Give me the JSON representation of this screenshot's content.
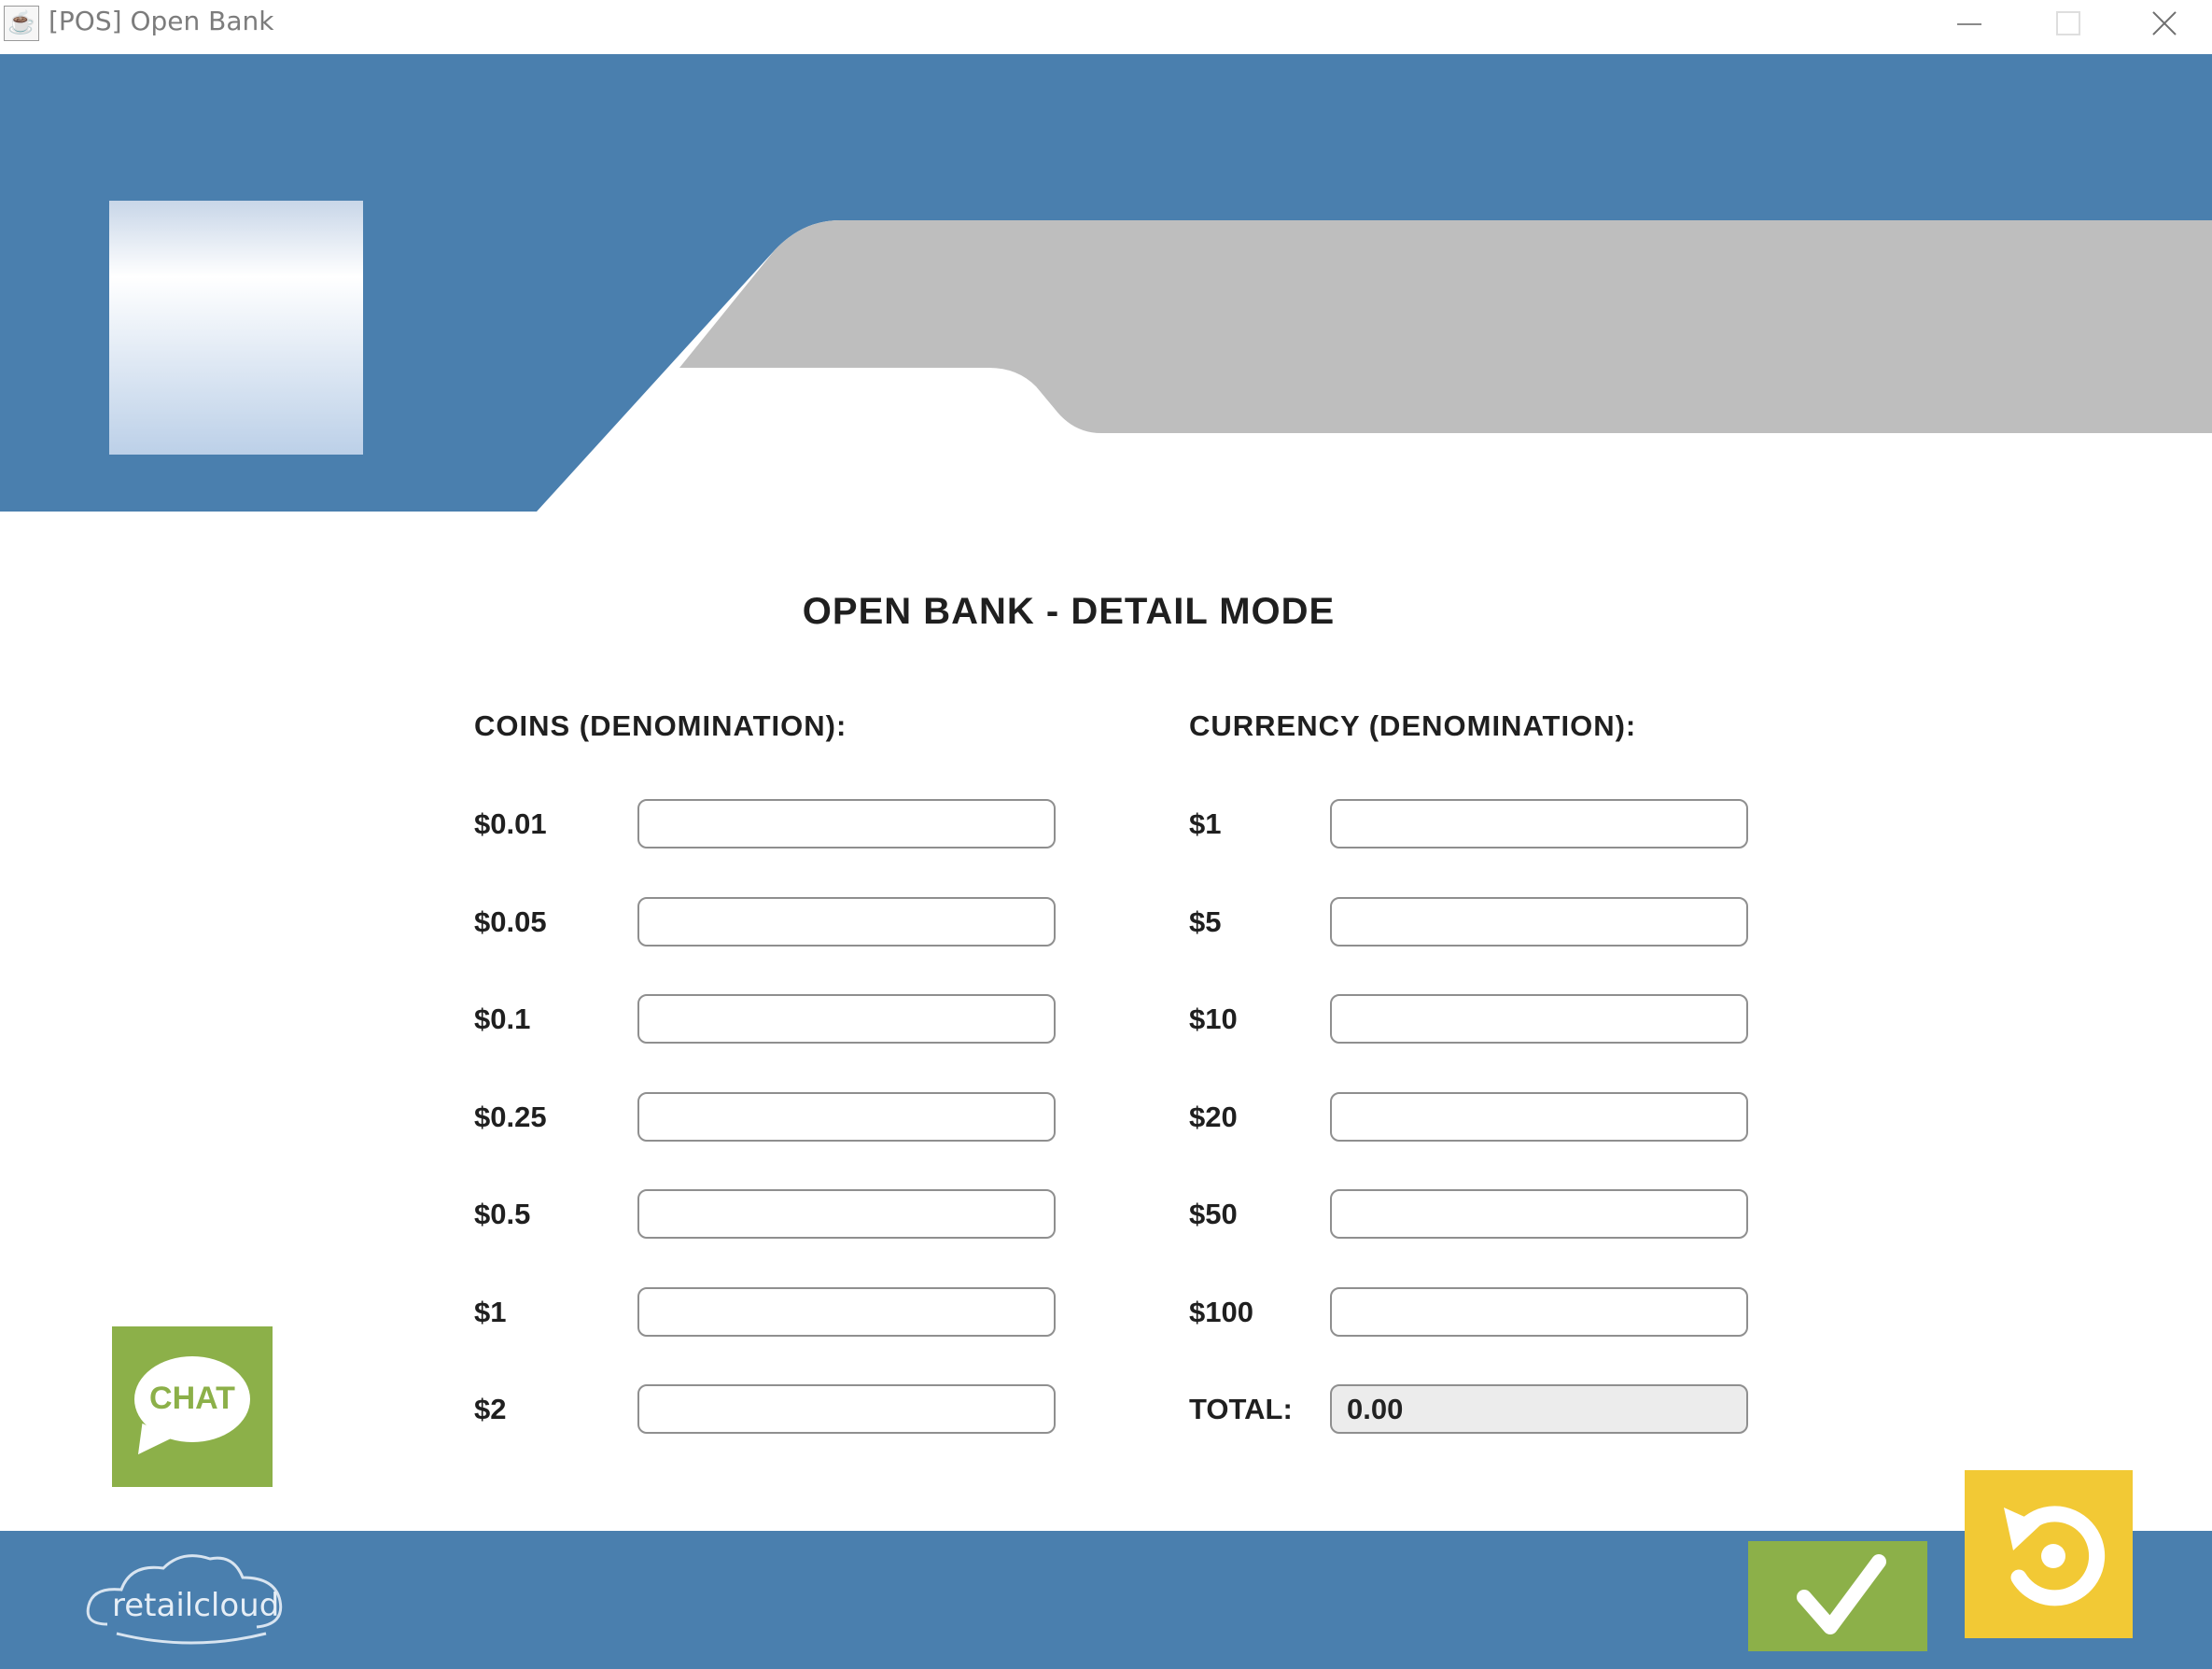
{
  "window": {
    "title": "[POS] Open Bank",
    "app_icon": "java-icon"
  },
  "form": {
    "title": "OPEN BANK - DETAIL MODE",
    "coins": {
      "heading": "COINS (DENOMINATION):",
      "rows": [
        {
          "label": "$0.01",
          "value": ""
        },
        {
          "label": "$0.05",
          "value": ""
        },
        {
          "label": "$0.1",
          "value": ""
        },
        {
          "label": "$0.25",
          "value": ""
        },
        {
          "label": "$0.5",
          "value": ""
        },
        {
          "label": "$1",
          "value": ""
        },
        {
          "label": "$2",
          "value": ""
        }
      ]
    },
    "currency": {
      "heading": "CURRENCY (DENOMINATION):",
      "rows": [
        {
          "label": "$1",
          "value": ""
        },
        {
          "label": "$5",
          "value": ""
        },
        {
          "label": "$10",
          "value": ""
        },
        {
          "label": "$20",
          "value": ""
        },
        {
          "label": "$50",
          "value": ""
        },
        {
          "label": "$100",
          "value": ""
        }
      ]
    },
    "total": {
      "label": "TOTAL:",
      "value": "0.00"
    }
  },
  "chat": {
    "label": "CHAT",
    "icon": "chat-bubble-icon"
  },
  "footer": {
    "brand": "retailcloud",
    "confirm_icon": "checkmark-icon",
    "undo_icon": "undo-icon"
  },
  "colors": {
    "header_blue": "#4a7fae",
    "band_gray": "#bebebe",
    "chat_green": "#8cb049",
    "confirm_green": "#8cb049",
    "undo_yellow": "#f2c935"
  }
}
